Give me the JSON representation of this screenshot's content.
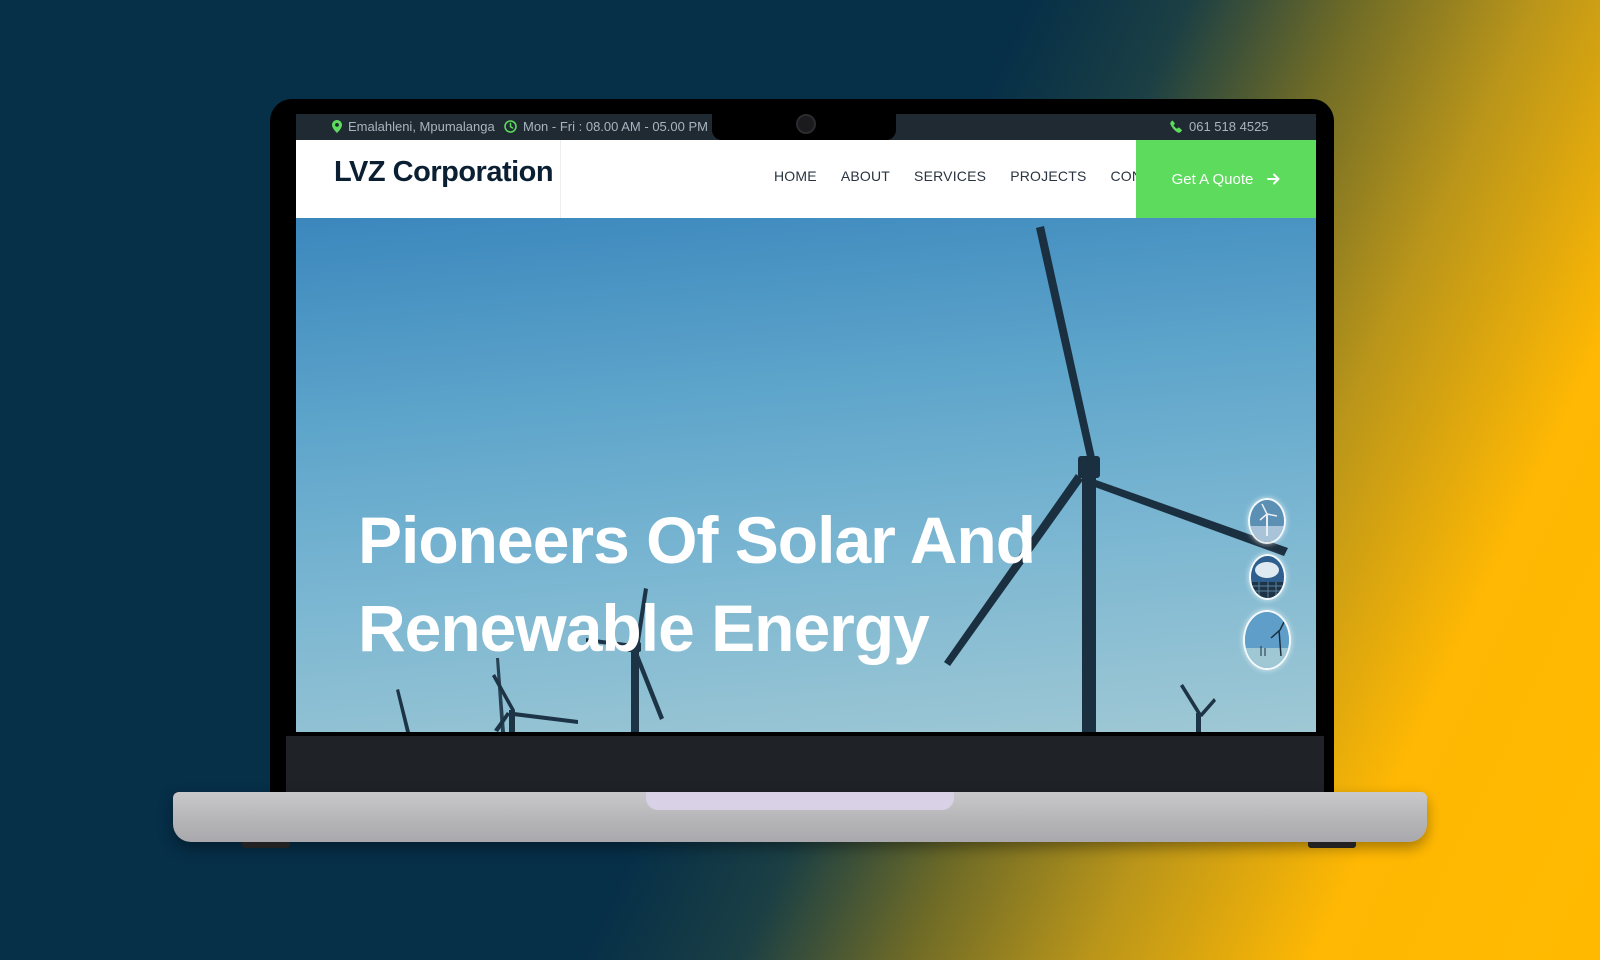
{
  "topbar": {
    "location": "Emalahleni, Mpumalanga",
    "hours": "Mon - Fri : 08.00 AM - 05.00 PM",
    "phone": "061 518 4525"
  },
  "navbar": {
    "brand": "LVZ Corporation",
    "links": [
      "HOME",
      "ABOUT",
      "SERVICES",
      "PROJECTS",
      "CONTACT"
    ],
    "cta_label": "Get A Quote"
  },
  "hero": {
    "title_line1": "Pioneers Of Solar And",
    "title_line2": "Renewable Energy"
  },
  "colors": {
    "accent_green": "#5cdb5c",
    "topbar_bg": "#1f2a33",
    "brand_text": "#0b1f33"
  },
  "icons": {
    "location": "map-pin-icon",
    "hours": "clock-icon",
    "phone": "phone-icon",
    "cta": "arrow-right-icon"
  }
}
